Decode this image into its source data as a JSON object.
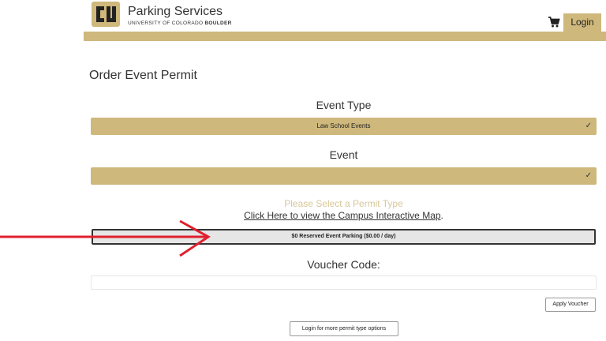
{
  "header": {
    "brand_title": "Parking Services",
    "brand_subtitle_prefix": "UNIVERSITY OF COLORADO",
    "brand_subtitle_bold": "BOULDER",
    "login_label": "Login",
    "logo_icon": "cu-logo-icon",
    "cart_icon": "cart-icon"
  },
  "page": {
    "title": "Order Event Permit"
  },
  "event_type": {
    "label": "Event Type",
    "selected": "Law School Events"
  },
  "event": {
    "label": "Event",
    "selected": ""
  },
  "permit": {
    "prompt": "Please Select a Permit Type",
    "map_link": "Click Here to view the Campus Interactive Map",
    "map_link_suffix": ".",
    "option": "$0 Reserved Event Parking ($0.00 / day)"
  },
  "voucher": {
    "label": "Voucher Code:",
    "value": "",
    "apply_label": "Apply Voucher"
  },
  "more_options_label": "Login for more permit type options",
  "colors": {
    "gold": "#cfb87c",
    "prompt_gold": "#d7c79a",
    "arrow_red": "#e0202e",
    "text": "#333333"
  }
}
